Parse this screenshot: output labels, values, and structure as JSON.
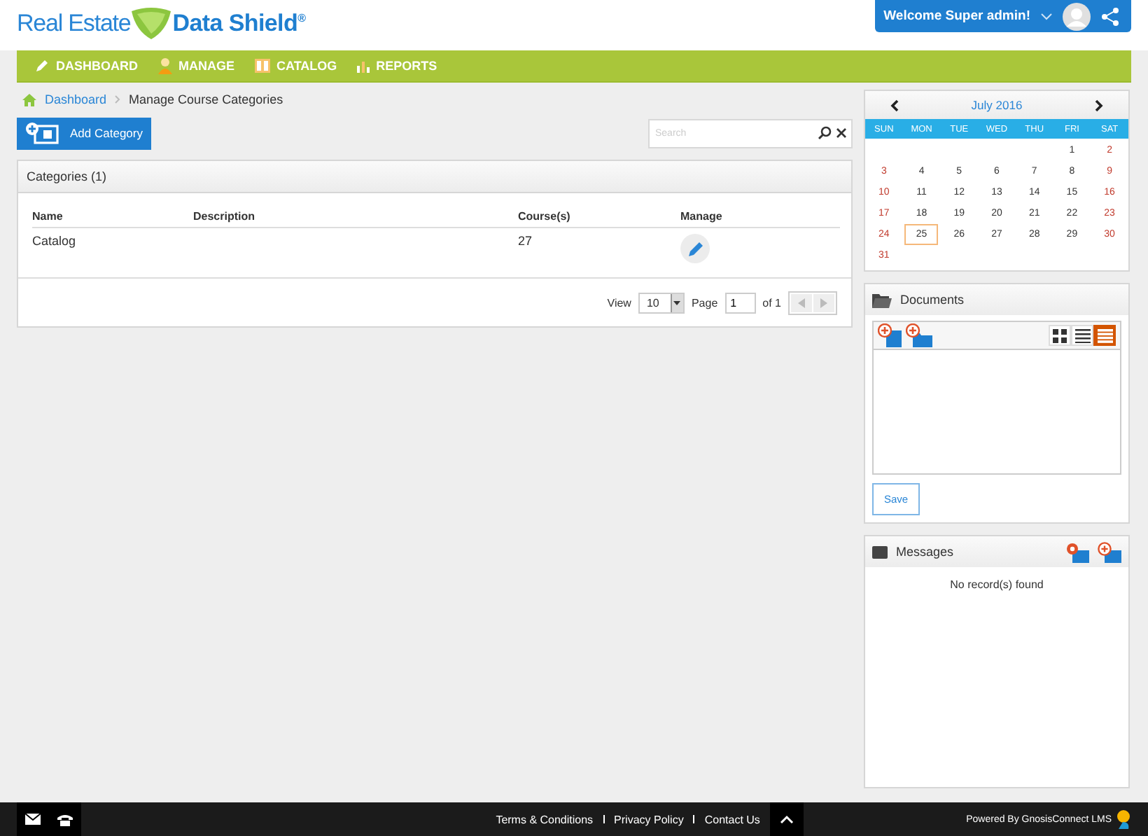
{
  "logo": {
    "left": "Real Estate",
    "right": "Data Shield",
    "mark": "®"
  },
  "user": {
    "greeting": "Welcome Super admin!"
  },
  "nav": [
    {
      "label": "DASHBOARD",
      "kind": "pencil"
    },
    {
      "label": "MANAGE",
      "kind": "person"
    },
    {
      "label": "CATALOG",
      "kind": "book"
    },
    {
      "label": "REPORTS",
      "kind": "chart"
    }
  ],
  "breadcrumb": [
    "Dashboard",
    "Manage Course Categories"
  ],
  "add_button": "Add Category",
  "search": {
    "placeholder": "Search"
  },
  "panel": {
    "title": "Categories (1)",
    "columns": [
      "Name",
      "Description",
      "Course(s)",
      "Manage"
    ],
    "rows": [
      {
        "name": "Catalog",
        "courses": "27"
      }
    ],
    "pager": {
      "view_label": "View",
      "view_value": "10",
      "page_label": "Page",
      "page_value": "1",
      "of": "of 1"
    }
  },
  "calendar": {
    "month": "July 2016",
    "weekdays": [
      "SUN",
      "MON",
      "TUE",
      "WED",
      "THU",
      "FRI",
      "SAT"
    ],
    "weeks": [
      [
        {
          "day": "1",
          "selected": false
        },
        {
          "day": "2",
          "selected": false
        }
      ],
      [
        {
          "day": "3",
          "selected": false
        },
        {
          "day": "4",
          "selected": false
        },
        {
          "day": "5",
          "selected": false
        },
        {
          "day": "6",
          "selected": false
        },
        {
          "day": "7",
          "selected": false
        },
        {
          "day": "8",
          "selected": false
        },
        {
          "day": "9",
          "selected": false
        }
      ],
      [
        {
          "day": "10",
          "selected": false
        },
        {
          "day": "11",
          "selected": false
        },
        {
          "day": "12",
          "selected": false
        },
        {
          "day": "13",
          "selected": false
        },
        {
          "day": "14",
          "selected": false
        },
        {
          "day": "15",
          "selected": false
        },
        {
          "day": "16",
          "selected": false
        }
      ],
      [
        {
          "day": "17",
          "selected": false
        },
        {
          "day": "18",
          "selected": false
        },
        {
          "day": "19",
          "selected": false
        },
        {
          "day": "20",
          "selected": false
        },
        {
          "day": "21",
          "selected": false
        },
        {
          "day": "22",
          "selected": false
        },
        {
          "day": "23",
          "selected": false
        }
      ],
      [
        {
          "day": "24",
          "selected": false
        },
        {
          "day": "25",
          "selected": true
        },
        {
          "day": "26",
          "selected": false
        },
        {
          "day": "27",
          "selected": false
        },
        {
          "day": "28",
          "selected": false
        },
        {
          "day": "29",
          "selected": false
        },
        {
          "day": "30",
          "selected": false
        }
      ],
      [
        {
          "day": "31",
          "selected": false
        }
      ]
    ]
  },
  "documents": {
    "title": "Documents",
    "views": [
      {
        "kind": "grid",
        "selected": false
      },
      {
        "kind": "list",
        "selected": false
      },
      {
        "kind": "details",
        "selected": true
      }
    ],
    "save": "Save"
  },
  "messages": {
    "title": "Messages",
    "empty": "No record(s) found"
  },
  "footer": {
    "links": [
      "Terms & Conditions",
      "Privacy Policy",
      "Contact Us"
    ],
    "powered": "Powered By GnosisConnect LMS"
  }
}
